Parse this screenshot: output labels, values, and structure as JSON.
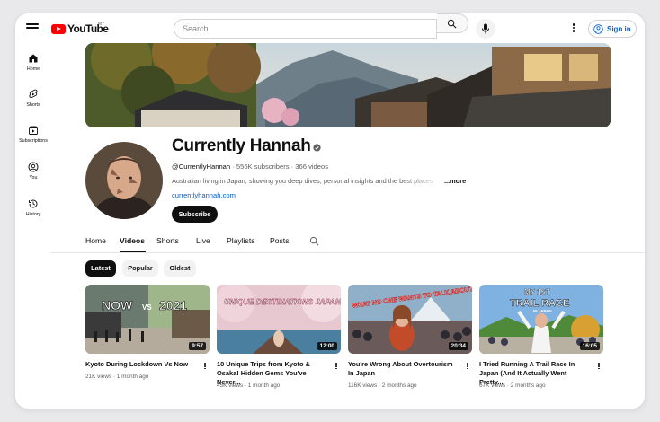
{
  "header": {
    "logo_text": "YouTube",
    "region": "MY",
    "search_placeholder": "Search",
    "signin_label": "Sign in"
  },
  "sidebar": {
    "items": [
      {
        "label": "Home",
        "icon": "home-icon"
      },
      {
        "label": "Shorts",
        "icon": "shorts-icon"
      },
      {
        "label": "Subscriptions",
        "icon": "subscriptions-icon"
      },
      {
        "label": "You",
        "icon": "you-icon"
      },
      {
        "label": "History",
        "icon": "history-icon"
      }
    ]
  },
  "channel": {
    "name": "Currently Hannah",
    "handle": "@CurrentlyHannah",
    "stats": " · 556K subscribers · 366 videos",
    "description": "Australian living in Japan, showing you deep dives, personal insights and the best places",
    "more_label": "...more",
    "link": "currentlyhannah.com",
    "subscribe_label": "Subscribe"
  },
  "tabs": [
    {
      "label": "Home",
      "active": false
    },
    {
      "label": "Videos",
      "active": true
    },
    {
      "label": "Shorts",
      "active": false
    },
    {
      "label": "Live",
      "active": false
    },
    {
      "label": "Playlists",
      "active": false
    },
    {
      "label": "Posts",
      "active": false
    }
  ],
  "chips": [
    {
      "label": "Latest",
      "selected": true
    },
    {
      "label": "Popular",
      "selected": false
    },
    {
      "label": "Oldest",
      "selected": false
    }
  ],
  "videos": [
    {
      "title": "Kyoto During Lockdown Vs Now",
      "duration": "9:57",
      "meta": "21K views · 1 month ago",
      "thumb_text": [
        "NOW",
        "VS",
        "2021"
      ]
    },
    {
      "title": "10 Unique Trips from Kyoto & Osaka! Hidden Gems You've Never...",
      "duration": "12:00",
      "meta": "45K views · 1 month ago",
      "thumb_text": [
        "UNIQUE DESTINATIONS JAPAN"
      ]
    },
    {
      "title": "You're Wrong About Overtourism In Japan",
      "duration": "20:34",
      "meta": "116K views · 2 months ago",
      "thumb_text": [
        "WHAT NO ONE WANTS TO TALK ABOUT"
      ]
    },
    {
      "title": "I Tried Running A Trail Race In Japan (And It Actually Went Pretty...",
      "duration": "16:05",
      "meta": "67K views · 2 months ago",
      "thumb_text": [
        "MY 1ST",
        "TRAIL RACE",
        "IN JAPAN"
      ]
    }
  ],
  "colors": {
    "brand_red": "#ff0000",
    "link_blue": "#065fd4",
    "text": "#0f0f0f",
    "muted": "#606060"
  }
}
